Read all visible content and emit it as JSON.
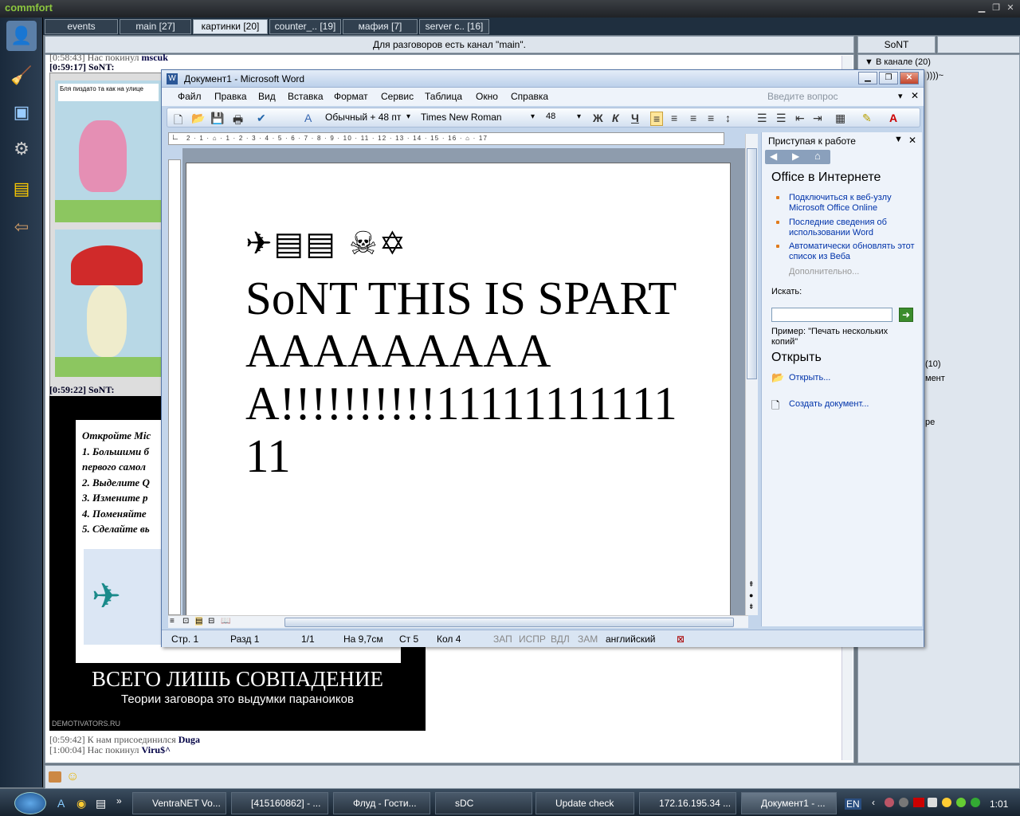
{
  "commfort": {
    "logo": "commfort",
    "tabs": [
      {
        "label": "events"
      },
      {
        "label": "main [27]"
      },
      {
        "label": "картинки [20]"
      },
      {
        "label": "counter_.. [19]"
      },
      {
        "label": "мафия [7]"
      },
      {
        "label": "server c.. [16]"
      }
    ],
    "topic": "Для разговоров есть канал \"main\".",
    "nick": "SoNT",
    "users_header": "В канале (20)",
    "users_header_suffix": "))))~",
    "users_count_2": "(10)",
    "users_frag_1": "мент",
    "users_frag_2": "ре",
    "chat": [
      {
        "time": "[0:58:43]",
        "text": "Нас покинул",
        "who": "mscuk"
      },
      {
        "time": "[0:59:17]",
        "text": "SoNT:",
        "who": ""
      },
      {
        "time": "[0:59:22]",
        "text": "SoNT:",
        "who": ""
      },
      {
        "time": "[0:59:42]",
        "text": "К нам присоединился",
        "who": "Duga"
      },
      {
        "time": "[1:00:04]",
        "text": "Нас покинул",
        "who": "Viru$^"
      }
    ],
    "comic_caption": "Бля пиздато та как на улице",
    "demotivator": {
      "lines": [
        "Откройте Mic",
        "1. Большими б",
        "первого самол",
        "2. Выделите Q",
        "3. Измените р",
        "4. Поменяйте",
        "5. Сделайте вь"
      ],
      "title": "ВСЕГО ЛИШЬ СОВПАДЕНИЕ",
      "subtitle": "Теории заговора это выдумки параноиков",
      "site": "DEMOTIVATORS.RU"
    }
  },
  "word": {
    "title": "Документ1 - Microsoft Word",
    "menu": [
      "Файл",
      "Правка",
      "Вид",
      "Вставка",
      "Формат",
      "Сервис",
      "Таблица",
      "Окно",
      "Справка"
    ],
    "ask_placeholder": "Введите вопрос",
    "style": "Обычный + 48 пт",
    "font": "Times New Roman",
    "size": "48",
    "bold": "Ж",
    "italic": "К",
    "underline": "Ч",
    "ruler_text": "2 · 1 · ⌂ · 1 · 2 · 3 · 4 · 5 · 6 · 7 · 8 · 9 · 10 · 11 · 12 · 13 · 14 · 15 · 16 · ⌂ · 17",
    "doc_symbols": "✈▤▤   ☠✡",
    "doc_text": "SoNT THIS IS SPARTAAAAAAAAAA!!!!!!!!!!1111111111111",
    "status": {
      "page": "Стр. 1",
      "section": "Разд 1",
      "pages": "1/1",
      "at": "На 9,7см",
      "line": "Ст 5",
      "col": "Кол 4",
      "rec": "ЗАП",
      "trk": "ИСПР",
      "ext": "ВДЛ",
      "ovr": "ЗАМ",
      "lang": "английский"
    },
    "taskpane": {
      "title": "Приступая к работе",
      "office_online": "Office в Интернете",
      "links": [
        "Подключиться к веб-узлу Microsoft Office Online",
        "Последние сведения об использовании Word",
        "Автоматически обновлять этот список из Веба"
      ],
      "more": "Дополнительно...",
      "search_label": "Искать:",
      "example": "Пример:  \"Печать нескольких копий\"",
      "open_header": "Открыть",
      "open_link": "Открыть...",
      "create_link": "Создать документ..."
    }
  },
  "taskbar": {
    "items": [
      {
        "label": "VentraNET Vo..."
      },
      {
        "label": "[415160862] - ..."
      },
      {
        "label": "Флуд - Гости..."
      },
      {
        "label": "sDC"
      },
      {
        "label": "Update check"
      },
      {
        "label": "172.16.195.34 ..."
      },
      {
        "label": "Документ1 - ..."
      }
    ],
    "lang": "EN",
    "clock": "1:01"
  }
}
